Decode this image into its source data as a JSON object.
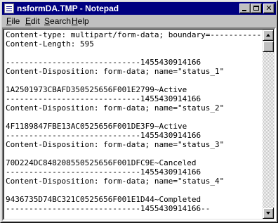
{
  "window": {
    "title": "nsformDA.TMP - Notepad",
    "minimize_icon": "minimize-icon",
    "maximize_icon": "maximize-icon",
    "close_icon": "close-icon",
    "close_glyph": "✕"
  },
  "menu": [
    {
      "label": "File",
      "mnemonic": "F",
      "rest": "ile"
    },
    {
      "label": "Edit",
      "mnemonic": "E",
      "rest": "dit"
    },
    {
      "label": "Search",
      "mnemonic": "S",
      "rest": "earch"
    },
    {
      "label": "Help",
      "mnemonic": "H",
      "rest": "elp"
    }
  ],
  "document": {
    "lines": [
      "Content-type: multipart/form-data; boundary=------------------",
      "Content-Length: 595",
      "",
      "-----------------------------1455430914166",
      "Content-Disposition: form-data; name=\"status_1\"",
      "",
      "1A2501973CBAFD350525656F001E2799~Active",
      "-----------------------------1455430914166",
      "Content-Disposition: form-data; name=\"status_2\"",
      "",
      "4F1189847FBE13AC0525656F001DE3F9~Active",
      "-----------------------------1455430914166",
      "Content-Disposition: form-data; name=\"status_3\"",
      "",
      "70D224DC848208550525656F001DFC9E~Canceled",
      "-----------------------------1455430914166",
      "Content-Disposition: form-data; name=\"status_4\"",
      "",
      "9436735D74BC321C0525656F001E1D44~Completed",
      "-----------------------------1455430914166--"
    ]
  },
  "colors": {
    "titlebar": "#000080",
    "chrome": "#c0c0c0",
    "editor_bg": "#ffffff"
  }
}
